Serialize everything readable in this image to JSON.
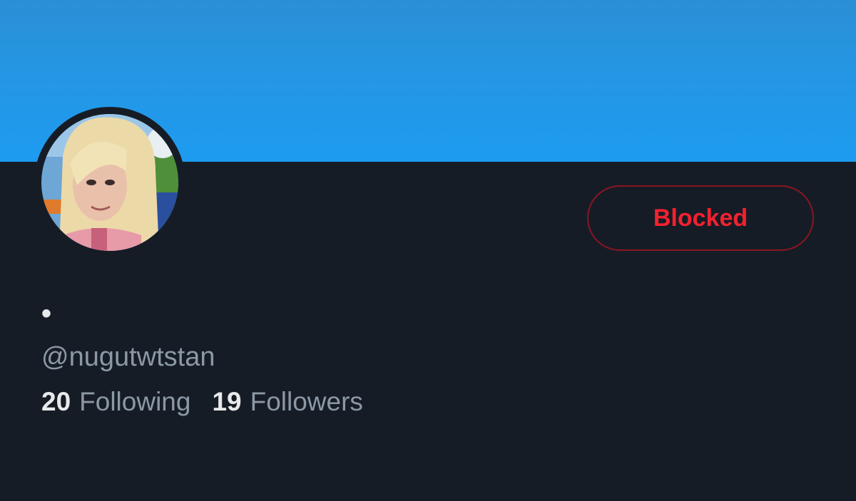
{
  "profile": {
    "display_name": "•",
    "handle": "@nugutwtstan",
    "following": {
      "count": "20",
      "label": "Following"
    },
    "followers": {
      "count": "19",
      "label": "Followers"
    }
  },
  "actions": {
    "blocked_label": "Blocked"
  },
  "colors": {
    "banner": "#1d9bf0",
    "background": "#161c26",
    "blocked_red": "#f4212e",
    "muted_text": "#8b98a5"
  }
}
